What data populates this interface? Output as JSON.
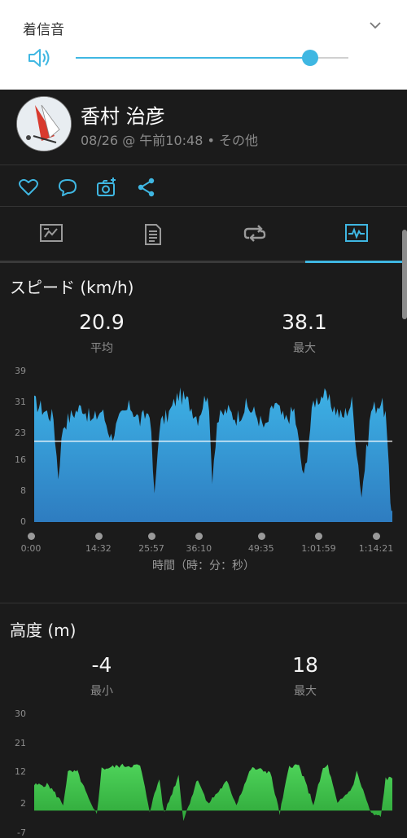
{
  "volume_panel": {
    "title": "着信音",
    "level_percent": 86
  },
  "activity": {
    "user_name": "香村 治彦",
    "meta": "08/26 @ 午前10:48 • その他"
  },
  "actions": [
    {
      "icon": "heart-icon"
    },
    {
      "icon": "comment-icon"
    },
    {
      "icon": "add-photo-icon"
    },
    {
      "icon": "share-icon"
    }
  ],
  "tabs": [
    {
      "icon": "overview-icon"
    },
    {
      "icon": "details-icon"
    },
    {
      "icon": "laps-icon"
    },
    {
      "icon": "charts-icon",
      "active": true
    }
  ],
  "colors": {
    "accent": "#3fb7e2",
    "speed_fill": "#2e9bd3",
    "elevation_fill": "#3dcc4a"
  },
  "speed": {
    "title": "スピード (km/h)",
    "avg_value": "20.9",
    "avg_label": "平均",
    "max_value": "38.1",
    "max_label": "最大",
    "x_axis_title": "時間（時：分：秒）"
  },
  "elevation": {
    "title": "高度 (m)",
    "min_value": "-4",
    "min_label": "最小",
    "max_value": "18",
    "max_label": "最大"
  },
  "chart_data": [
    {
      "type": "area",
      "title": "スピード (km/h)",
      "xlabel": "時間（時：分：秒）",
      "ylabel": "",
      "ylim": [
        0,
        39
      ],
      "yticks": [
        "0",
        "8",
        "16",
        "23",
        "31",
        "39"
      ],
      "xticks": [
        "0:00",
        "14:32",
        "25:57",
        "36:10",
        "49:35",
        "1:01:59",
        "1:14:21"
      ],
      "average_line": 20.9,
      "x_minutes": [
        0,
        2,
        4,
        5,
        6,
        8,
        10,
        12,
        14,
        16,
        18,
        20,
        22,
        24,
        25,
        26,
        28,
        30,
        32,
        34,
        36,
        37,
        38,
        40,
        42,
        44,
        46,
        48,
        50,
        52,
        54,
        56,
        58,
        60,
        62,
        64,
        66,
        68,
        70,
        72,
        73,
        74,
        74.4
      ],
      "values": [
        31,
        29,
        27,
        12,
        25,
        28,
        30,
        26,
        29,
        22,
        27,
        30,
        26,
        29,
        6,
        25,
        28,
        33,
        31,
        27,
        34,
        12,
        26,
        29,
        27,
        30,
        28,
        24,
        31,
        26,
        29,
        11,
        31,
        33,
        30,
        27,
        31,
        7,
        29,
        31,
        28,
        5,
        3
      ],
      "grid": false,
      "legend": "none"
    },
    {
      "type": "area",
      "title": "高度 (m)",
      "xlabel": "",
      "ylabel": "",
      "ylim": [
        -7,
        30
      ],
      "yticks": [
        "-7",
        "2",
        "12",
        "21",
        "30"
      ],
      "x_minutes": [
        0,
        3,
        6,
        7,
        9,
        12,
        13,
        14,
        18,
        22,
        24,
        26,
        27,
        30,
        31,
        34,
        36,
        40,
        42,
        45,
        46,
        49,
        51,
        53,
        55,
        58,
        60,
        61,
        63,
        66,
        67,
        70,
        72,
        73,
        74.4
      ],
      "values": [
        8,
        8,
        2,
        12,
        12,
        1,
        -1,
        13,
        14,
        14,
        0,
        10,
        -1,
        11,
        -3,
        10,
        2,
        9,
        2,
        13,
        13,
        12,
        -1,
        14,
        14,
        2,
        13,
        14,
        2,
        7,
        12,
        -1,
        -2,
        10,
        10
      ],
      "grid": false,
      "legend": "none"
    }
  ]
}
